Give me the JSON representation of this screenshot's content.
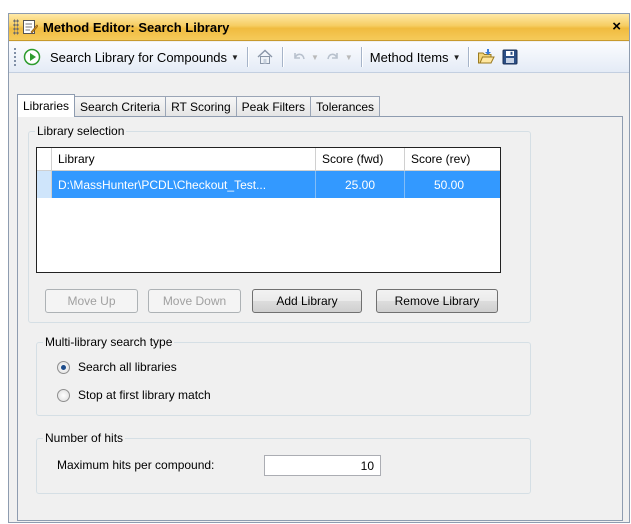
{
  "window": {
    "title": "Method Editor: Search Library",
    "close_glyph": "×"
  },
  "toolbar": {
    "run_label": "Search Library for Compounds",
    "method_items_label": "Method Items"
  },
  "tabs": [
    {
      "label": "Libraries",
      "active": true
    },
    {
      "label": "Search Criteria",
      "active": false
    },
    {
      "label": "RT Scoring",
      "active": false
    },
    {
      "label": "Peak Filters",
      "active": false
    },
    {
      "label": "Tolerances",
      "active": false
    }
  ],
  "library_selection": {
    "group_title": "Library selection",
    "columns": [
      "Library",
      "Score (fwd)",
      "Score (rev)"
    ],
    "rows": [
      {
        "library": "D:\\MassHunter\\PCDL\\Checkout_Test...",
        "score_fwd": "25.00",
        "score_rev": "50.00",
        "selected": true
      }
    ],
    "buttons": {
      "move_up": "Move Up",
      "move_down": "Move Down",
      "add_library": "Add Library",
      "remove_library": "Remove Library"
    }
  },
  "multi_library": {
    "group_title": "Multi-library search type",
    "options": [
      {
        "label": "Search all libraries",
        "checked": true
      },
      {
        "label": "Stop at first library match",
        "checked": false
      }
    ]
  },
  "number_of_hits": {
    "group_title": "Number of hits",
    "max_hits_label": "Maximum hits per compound:",
    "max_hits_value": "10"
  },
  "colors": {
    "title_bar": "#f0bb3f",
    "selection": "#3399ff",
    "run_icon": "#2e9c2e"
  }
}
